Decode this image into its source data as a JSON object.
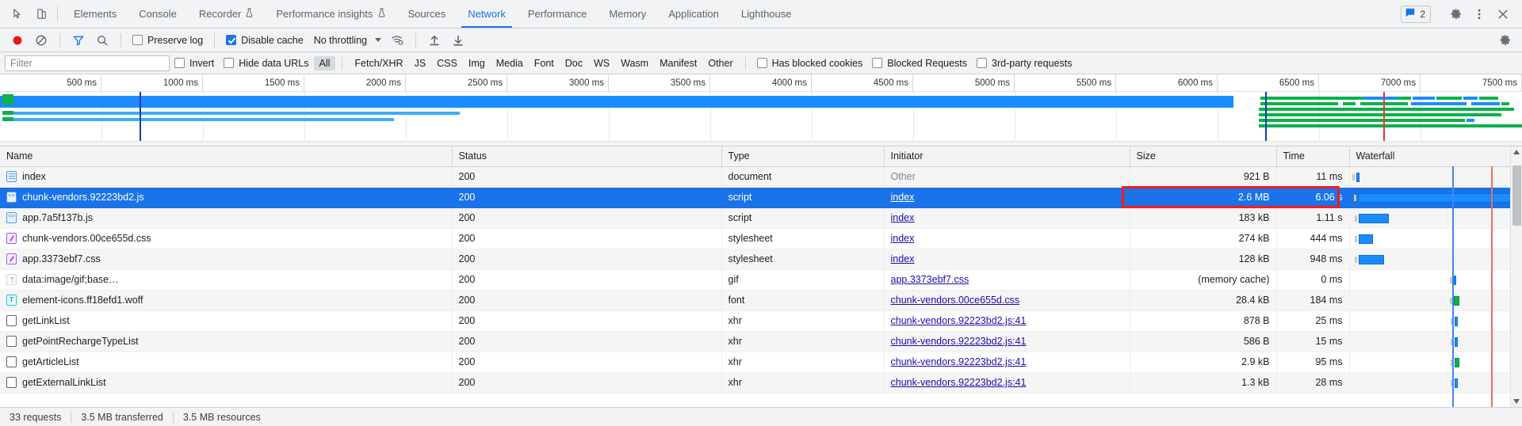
{
  "window": {
    "tabs": [
      {
        "label": "Elements",
        "active": false,
        "warn": false
      },
      {
        "label": "Console",
        "active": false,
        "warn": false
      },
      {
        "label": "Recorder",
        "active": false,
        "warn": true
      },
      {
        "label": "Performance insights",
        "active": false,
        "warn": true
      },
      {
        "label": "Sources",
        "active": false,
        "warn": false
      },
      {
        "label": "Network",
        "active": true,
        "warn": false
      },
      {
        "label": "Performance",
        "active": false,
        "warn": false
      },
      {
        "label": "Memory",
        "active": false,
        "warn": false
      },
      {
        "label": "Application",
        "active": false,
        "warn": false
      },
      {
        "label": "Lighthouse",
        "active": false,
        "warn": false
      }
    ],
    "message_count": "2",
    "icons": {
      "inspect": "inspect-element-icon",
      "device": "device-toolbar-icon",
      "messages": "messages-icon",
      "settings": "gear-icon",
      "more": "more-vertical-icon",
      "close": "close-icon"
    }
  },
  "toolbar": {
    "record_title": "record-button",
    "clear_title": "clear-button",
    "filter_title": "filter-button",
    "search_title": "search-button",
    "preserve_log_label": "Preserve log",
    "preserve_log_checked": false,
    "disable_cache_label": "Disable cache",
    "disable_cache_checked": true,
    "throttling_label": "No throttling",
    "wifi_title": "network-conditions-icon",
    "import_title": "import-har-icon",
    "export_title": "export-har-icon",
    "settings_title": "network-settings-icon"
  },
  "filterbar": {
    "placeholder": "Filter",
    "invert_label": "Invert",
    "invert_checked": false,
    "hide_data_urls_label": "Hide data URLs",
    "hide_data_urls_checked": false,
    "types": [
      "All",
      "Fetch/XHR",
      "JS",
      "CSS",
      "Img",
      "Media",
      "Font",
      "Doc",
      "WS",
      "Wasm",
      "Manifest",
      "Other"
    ],
    "selected_type": "All",
    "has_blocked_cookies_label": "Has blocked cookies",
    "has_blocked_cookies_checked": false,
    "blocked_requests_label": "Blocked Requests",
    "blocked_requests_checked": false,
    "third_party_label": "3rd-party requests",
    "third_party_checked": false
  },
  "timeline": {
    "ticks": [
      "500 ms",
      "1000 ms",
      "1500 ms",
      "2000 ms",
      "2500 ms",
      "3000 ms",
      "3500 ms",
      "4000 ms",
      "4500 ms",
      "5000 ms",
      "5500 ms",
      "6000 ms",
      "6500 ms",
      "7000 ms",
      "7500 ms"
    ],
    "dom_content_loaded_color": "#0b3fad",
    "load_event_color": "#e53935"
  },
  "table": {
    "columns": [
      {
        "label": "Name",
        "align": "left"
      },
      {
        "label": "Status",
        "align": "left"
      },
      {
        "label": "Type",
        "align": "left"
      },
      {
        "label": "Initiator",
        "align": "left"
      },
      {
        "label": "Size",
        "align": "right"
      },
      {
        "label": "Time",
        "align": "right"
      },
      {
        "label": "Waterfall",
        "align": "left"
      }
    ],
    "rows": [
      {
        "name": "index",
        "icon": "document-file-icon",
        "status": "200",
        "type": "document",
        "initiator": "Other",
        "initiator_link": false,
        "size": "921 B",
        "size_muted": false,
        "time": "11 ms",
        "selected": false
      },
      {
        "name": "chunk-vendors.92223bd2.js",
        "icon": "script-file-icon",
        "status": "200",
        "type": "script",
        "initiator": "index",
        "initiator_link": true,
        "size": "2.6 MB",
        "size_muted": false,
        "time": "6.06 s",
        "selected": true
      },
      {
        "name": "app.7a5f137b.js",
        "icon": "script-file-icon",
        "status": "200",
        "type": "script",
        "initiator": "index",
        "initiator_link": true,
        "size": "183 kB",
        "size_muted": false,
        "time": "1.11 s",
        "selected": false
      },
      {
        "name": "chunk-vendors.00ce655d.css",
        "icon": "stylesheet-file-icon",
        "status": "200",
        "type": "stylesheet",
        "initiator": "index",
        "initiator_link": true,
        "size": "274 kB",
        "size_muted": false,
        "time": "444 ms",
        "selected": false
      },
      {
        "name": "app.3373ebf7.css",
        "icon": "stylesheet-file-icon",
        "status": "200",
        "type": "stylesheet",
        "initiator": "index",
        "initiator_link": true,
        "size": "128 kB",
        "size_muted": false,
        "time": "948 ms",
        "selected": false
      },
      {
        "name": "data:image/gif;base…",
        "icon": "image-file-icon",
        "status": "200",
        "type": "gif",
        "initiator": "app.3373ebf7.css",
        "initiator_link": true,
        "size": "(memory cache)",
        "size_muted": true,
        "time": "0 ms",
        "selected": false
      },
      {
        "name": "element-icons.ff18efd1.woff",
        "icon": "font-file-icon",
        "status": "200",
        "type": "font",
        "initiator": "chunk-vendors.00ce655d.css",
        "initiator_link": true,
        "size": "28.4 kB",
        "size_muted": false,
        "time": "184 ms",
        "selected": false
      },
      {
        "name": "getLinkList",
        "icon": "xhr-file-icon",
        "status": "200",
        "type": "xhr",
        "initiator": "chunk-vendors.92223bd2.js:41",
        "initiator_link": true,
        "size": "878 B",
        "size_muted": false,
        "time": "25 ms",
        "selected": false
      },
      {
        "name": "getPointRechargeTypeList",
        "icon": "xhr-file-icon",
        "status": "200",
        "type": "xhr",
        "initiator": "chunk-vendors.92223bd2.js:41",
        "initiator_link": true,
        "size": "586 B",
        "size_muted": false,
        "time": "15 ms",
        "selected": false
      },
      {
        "name": "getArticleList",
        "icon": "xhr-file-icon",
        "status": "200",
        "type": "xhr",
        "initiator": "chunk-vendors.92223bd2.js:41",
        "initiator_link": true,
        "size": "2.9 kB",
        "size_muted": false,
        "time": "95 ms",
        "selected": false
      },
      {
        "name": "getExternalLinkList",
        "icon": "xhr-file-icon",
        "status": "200",
        "type": "xhr",
        "initiator": "chunk-vendors.92223bd2.js:41",
        "initiator_link": true,
        "size": "1.3 kB",
        "size_muted": false,
        "time": "28 ms",
        "selected": false
      }
    ]
  },
  "annotation": {
    "color": "#ff1a1a",
    "target": "size-and-time-of-selected-row"
  },
  "statusbar": {
    "requests": "33 requests",
    "transferred": "3.5 MB transferred",
    "resources": "3.5 MB resources"
  }
}
